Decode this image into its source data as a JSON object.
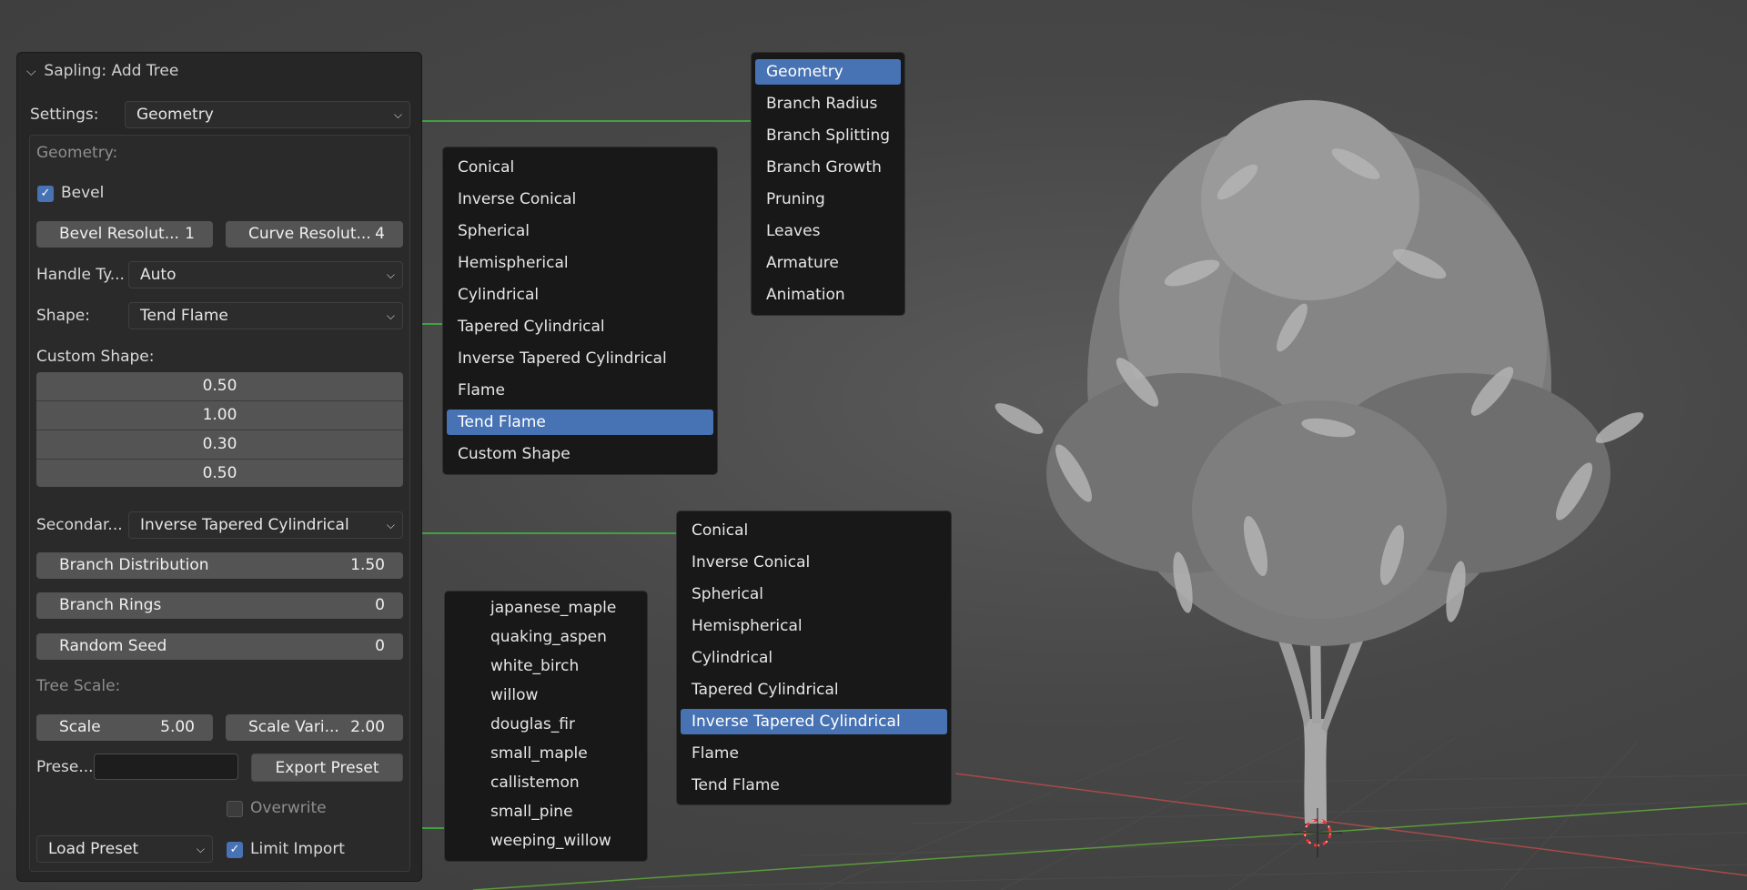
{
  "panel": {
    "title": "Sapling: Add Tree",
    "settings_label": "Settings:",
    "settings_value": "Geometry",
    "geometry_heading": "Geometry:",
    "bevel_label": "Bevel",
    "bevel_checked": true,
    "bevel_resolution_label": "Bevel Resolut...",
    "bevel_resolution_value": "1",
    "curve_resolution_label": "Curve Resolut...",
    "curve_resolution_value": "4",
    "handle_type_label": "Handle Ty...",
    "handle_type_value": "Auto",
    "shape_label": "Shape:",
    "shape_value": "Tend Flame",
    "custom_shape_label": "Custom Shape:",
    "custom_shape_values": [
      "0.50",
      "1.00",
      "0.30",
      "0.50"
    ],
    "secondary_label": "Secondar...",
    "secondary_value": "Inverse Tapered Cylindrical",
    "branch_distribution_label": "Branch Distribution",
    "branch_distribution_value": "1.50",
    "branch_rings_label": "Branch Rings",
    "branch_rings_value": "0",
    "random_seed_label": "Random Seed",
    "random_seed_value": "0",
    "tree_scale_heading": "Tree Scale:",
    "scale_label": "Scale",
    "scale_value": "5.00",
    "scale_variation_label": "Scale Vari...",
    "scale_variation_value": "2.00",
    "preset_label": "Prese...",
    "preset_name_value": "",
    "export_preset_label": "Export Preset",
    "overwrite_label": "Overwrite",
    "overwrite_checked": false,
    "load_preset_label": "Load Preset",
    "limit_import_label": "Limit Import",
    "limit_import_checked": true
  },
  "settings_menu": {
    "items": [
      "Geometry",
      "Branch Radius",
      "Branch Splitting",
      "Branch Growth",
      "Pruning",
      "Leaves",
      "Armature",
      "Animation"
    ],
    "selected": "Geometry"
  },
  "shape_menu": {
    "items": [
      "Conical",
      "Inverse Conical",
      "Spherical",
      "Hemispherical",
      "Cylindrical",
      "Tapered Cylindrical",
      "Inverse Tapered Cylindrical",
      "Flame",
      "Tend Flame",
      "Custom Shape"
    ],
    "selected": "Tend Flame"
  },
  "secondary_menu": {
    "items": [
      "Conical",
      "Inverse Conical",
      "Spherical",
      "Hemispherical",
      "Cylindrical",
      "Tapered Cylindrical",
      "Inverse Tapered Cylindrical",
      "Flame",
      "Tend Flame"
    ],
    "selected": "Inverse Tapered Cylindrical"
  },
  "preset_menu": {
    "items": [
      "japanese_maple",
      "quaking_aspen",
      "white_birch",
      "willow",
      "douglas_fir",
      "small_maple",
      "callistemon",
      "small_pine",
      "weeping_willow"
    ]
  },
  "colors": {
    "accent": "#4772b3",
    "connector": "#3fbf3f",
    "panel": "#262626",
    "field": "#545454",
    "menu": "#181818"
  }
}
